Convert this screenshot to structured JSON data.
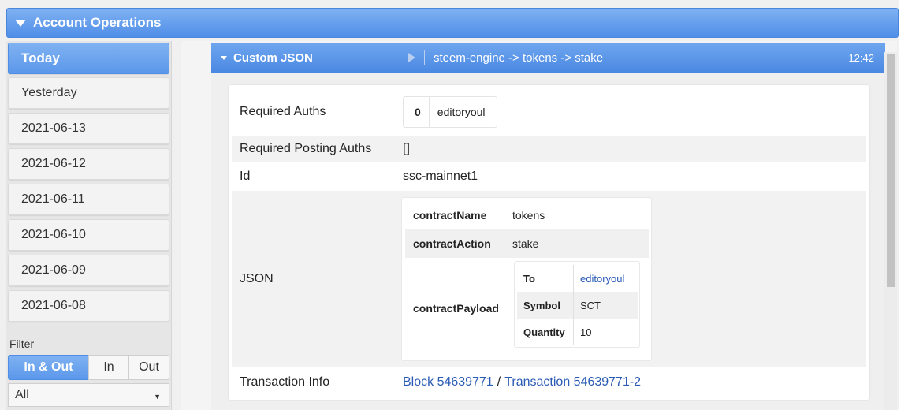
{
  "section": {
    "title": "Account Operations"
  },
  "sidebar": {
    "days": [
      "Today",
      "Yesterday",
      "2021-06-13",
      "2021-06-12",
      "2021-06-11",
      "2021-06-10",
      "2021-06-09",
      "2021-06-08"
    ],
    "filter_label": "Filter",
    "filter_options": [
      "In & Out",
      "In",
      "Out"
    ],
    "select_value": "All"
  },
  "operation": {
    "type": "Custom JSON",
    "path": "steem-engine -> tokens -> stake",
    "time": "12:42"
  },
  "details": {
    "required_auths_label": "Required Auths",
    "required_auths": [
      {
        "index": "0",
        "name": "editoryoul"
      }
    ],
    "required_posting_label": "Required Posting Auths",
    "required_posting_value": "[]",
    "id_label": "Id",
    "id_value": "ssc-mainnet1",
    "json_label": "JSON",
    "json": {
      "contract_name_label": "contractName",
      "contract_name": "tokens",
      "contract_action_label": "contractAction",
      "contract_action": "stake",
      "contract_payload_label": "contractPayload",
      "payload": {
        "to_label": "To",
        "to": "editoryoul",
        "symbol_label": "Symbol",
        "symbol": "SCT",
        "quantity_label": "Quantity",
        "quantity": "10"
      }
    },
    "tx_label": "Transaction Info",
    "block_link": "Block 54639771",
    "tx_sep": "/",
    "tx_link": "Transaction 54639771-2"
  }
}
